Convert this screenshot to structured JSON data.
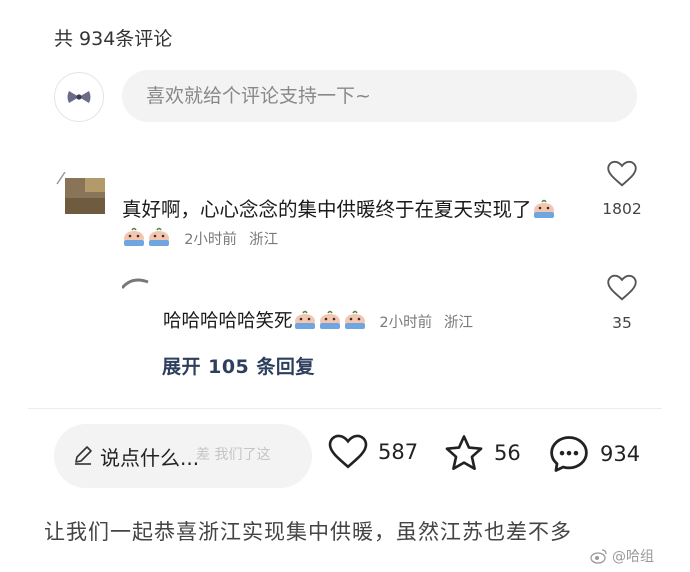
{
  "header": {
    "total_comments": "共 934条评论"
  },
  "composer": {
    "placeholder": "喜欢就给个评论支持一下~"
  },
  "comments": [
    {
      "text": "真好啊，心心念念的集中供暖终于在夏天实现了",
      "emoji_count": 3,
      "time": "2小时前",
      "location": "浙江",
      "likes": "1802",
      "replies": [
        {
          "text": "哈哈哈哈哈笑死",
          "emoji_count": 3,
          "time": "2小时前",
          "location": "浙江",
          "likes": "35"
        }
      ],
      "expand_label": "展开 105 条回复"
    }
  ],
  "action_bar": {
    "say_label": "说点什么...",
    "watermark_text": "差 我们了这",
    "likes": "587",
    "favorites": "56",
    "comments": "934"
  },
  "footer": {
    "caption": "让我们一起恭喜浙江实现集中供暖，虽然江苏也差不多",
    "watermark": "@哈组"
  },
  "icons": {
    "heart": "heart-icon",
    "star": "star-icon",
    "chat": "chat-bubble-icon",
    "pencil": "pencil-icon",
    "weibo": "weibo-logo-icon"
  },
  "colors": {
    "expand_link": "#2e3f5e",
    "meta": "#7a7a7a",
    "input_bg": "#f3f3f3"
  }
}
